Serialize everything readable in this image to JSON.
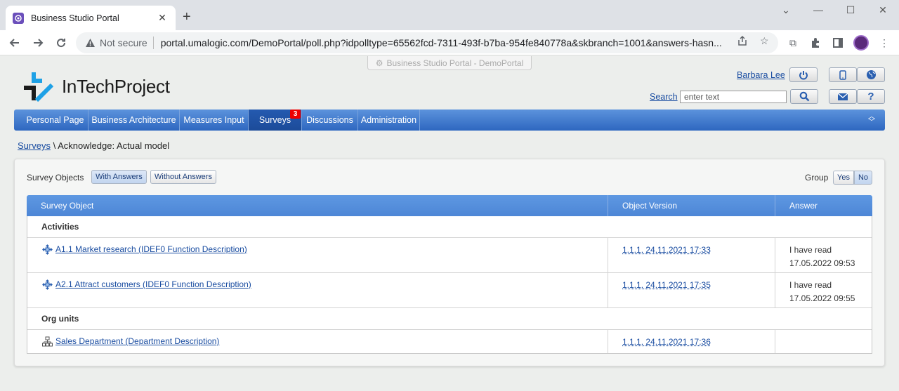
{
  "browser": {
    "tab_title": "Business Studio Portal",
    "not_secure": "Not secure",
    "url": "portal.umalogic.com/DemoPortal/poll.php?idpolltype=65562fcd-7311-493f-b7ba-954fe840778a&skbranch=1001&answers-hasn..."
  },
  "portal": {
    "chip": "Business Studio Portal - DemoPortal",
    "logo_text": "InTechProject",
    "user_name": "Barbara Lee",
    "search_label": "Search",
    "search_placeholder": "enter text"
  },
  "menu": {
    "items": [
      {
        "label": "Personal Page"
      },
      {
        "label": "Business Architecture"
      },
      {
        "label": "Measures Input"
      },
      {
        "label": "Surveys"
      },
      {
        "label": "Discussions"
      },
      {
        "label": "Administration"
      }
    ],
    "surveys_badge": "3"
  },
  "breadcrumb": {
    "root": "Surveys",
    "separator": "\\",
    "current": "Acknowledge: Actual model"
  },
  "filters": {
    "label": "Survey Objects",
    "with_answers": "With Answers",
    "without_answers": "Without Answers",
    "group_label": "Group",
    "yes": "Yes",
    "no": "No"
  },
  "table": {
    "headers": [
      "Survey Object",
      "Object Version",
      "Answer"
    ],
    "groups": [
      {
        "name": "Activities",
        "rows": [
          {
            "object": "A1.1 Market research (IDEF0 Function Description)",
            "version": "1.1.1, 24.11.2021 17:33",
            "answer_line1": "I have read",
            "answer_line2": "17.05.2022 09:53"
          },
          {
            "object": "A2.1 Attract customers (IDEF0 Function Description)",
            "version": "1.1.1, 24.11.2021 17:35",
            "answer_line1": "I have read",
            "answer_line2": "17.05.2022 09:55"
          }
        ]
      },
      {
        "name": "Org units",
        "rows": [
          {
            "object": "Sales Department (Department Description)",
            "version": "1.1.1, 24.11.2021 17:36",
            "answer_line1": "",
            "answer_line2": ""
          }
        ]
      }
    ]
  },
  "colors": {
    "menu_blue": "#2e67c0",
    "header_blue": "#5e98e2",
    "link_blue": "#1a4da1",
    "badge_red": "#e00000"
  }
}
